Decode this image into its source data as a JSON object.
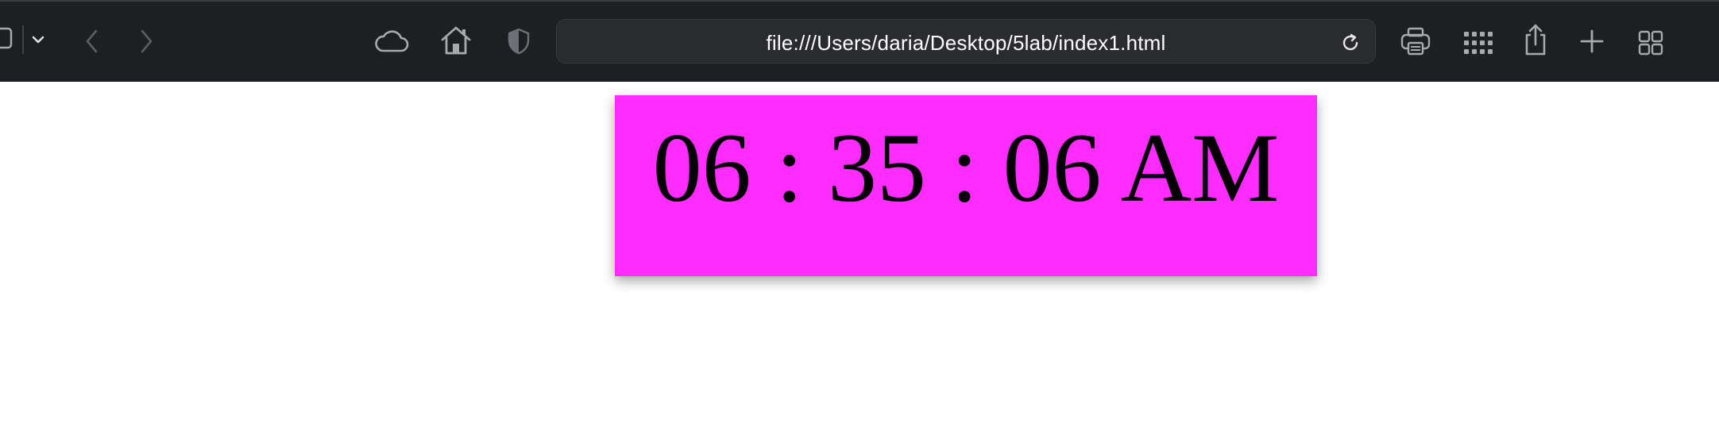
{
  "browser": {
    "url": "file:///Users/daria/Desktop/5lab/index1.html",
    "icons": {
      "sidebar": "sidebar-icon",
      "dropdown": "chevron-down-icon",
      "back": "chevron-left-icon",
      "forward": "chevron-right-icon",
      "cloud": "cloud-icon",
      "home": "home-icon",
      "privacy": "shield-icon",
      "reload": "reload-icon",
      "print": "printer-icon",
      "extensions": "grid-dots-icon",
      "share": "share-icon",
      "new_tab": "plus-icon",
      "tab_overview": "tab-overview-icon"
    },
    "colors": {
      "toolbar_bg": "#1e1f22",
      "address_bg": "#2a2b2e",
      "icon": "#a7a9ad"
    }
  },
  "page": {
    "clock_text": "06 : 35 : 06 AM",
    "clock_bg": "#ff2cff",
    "background": "#ffffff"
  }
}
